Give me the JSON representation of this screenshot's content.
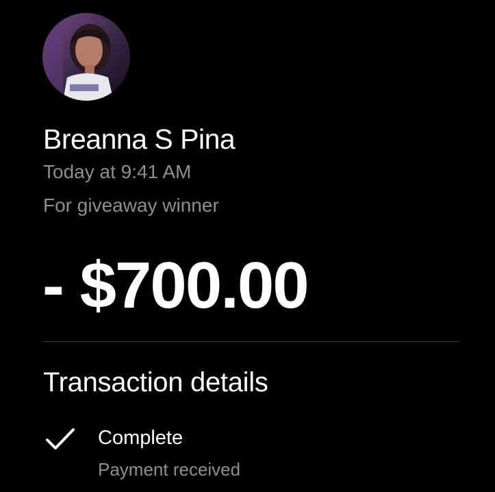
{
  "recipient": {
    "name": "Breanna S Pina",
    "avatar_icon": "profile-photo",
    "time": "Today at 9:41 AM",
    "note": "For giveaway winner"
  },
  "payment": {
    "amount": "- $700.00"
  },
  "details": {
    "title": "Transaction details",
    "status_icon": "checkmark-icon",
    "status": "Complete",
    "status_sub": "Payment received"
  },
  "colors": {
    "background": "#000000",
    "primary_text": "#ffffff",
    "secondary_text": "#8e8e93",
    "divider": "#3a3a3c"
  }
}
